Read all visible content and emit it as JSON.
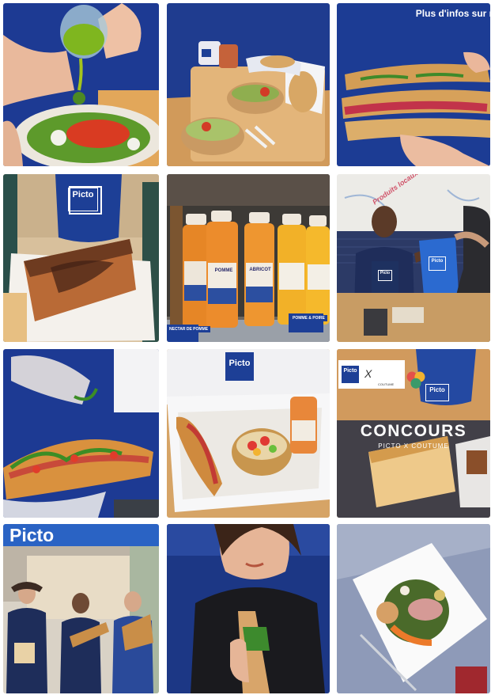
{
  "tiles": [
    {
      "id": "oil-pouring-salad"
    },
    {
      "id": "bowls-sandwich-tray"
    },
    {
      "id": "sandwich-hands",
      "caption": "Plus d'infos sur n"
    },
    {
      "id": "cake-coffee-cup",
      "cup_logo": "Picto"
    },
    {
      "id": "juice-bottles",
      "bottle_label": "ABRICOT",
      "bottle_label_2": "POMME",
      "shelf_tag": "NECTAR DE POMME",
      "shelf_tag_2": "POMME & POIRE"
    },
    {
      "id": "staff-handing-bag",
      "wall_text": "Produits locaux",
      "bag_logo": "Picto",
      "apron_logo": "Picto"
    },
    {
      "id": "arugula-sandwich"
    },
    {
      "id": "box-sandwich-fruit",
      "box_logo": "Picto"
    },
    {
      "id": "concours",
      "title": "CONCOURS",
      "subtitle": "PICTO X COUTUME",
      "partner_picto": "Picto",
      "partner_x": "X",
      "partner_coutume": "COUTUME",
      "cup_logo": "Picto"
    },
    {
      "id": "store-team",
      "store_sign": "Picto"
    },
    {
      "id": "woman-sandwich"
    },
    {
      "id": "salad-plate"
    }
  ],
  "colors": {
    "brand_blue": "#1d3f96",
    "sign_blue": "#2a63c4"
  }
}
